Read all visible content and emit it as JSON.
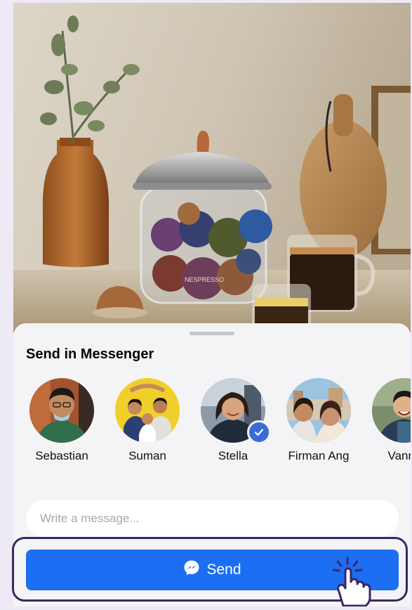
{
  "sheet": {
    "title": "Send in Messenger"
  },
  "contacts": [
    {
      "name": "Sebastian",
      "selected": false
    },
    {
      "name": "Suman",
      "selected": false
    },
    {
      "name": "Stella",
      "selected": true
    },
    {
      "name": "Firman Ang",
      "selected": false
    },
    {
      "name": "Vanny",
      "selected": false
    }
  ],
  "message": {
    "placeholder": "Write a message...",
    "value": ""
  },
  "send_button": {
    "label": "Send",
    "icon": "messenger-icon"
  },
  "photo": {
    "brand_text": "NESPRESSO"
  },
  "colors": {
    "send_blue": "#1c6ef2",
    "check_blue": "#3b6bd6",
    "highlight_purple": "#3d2664",
    "page_background": "#ede9f5"
  }
}
